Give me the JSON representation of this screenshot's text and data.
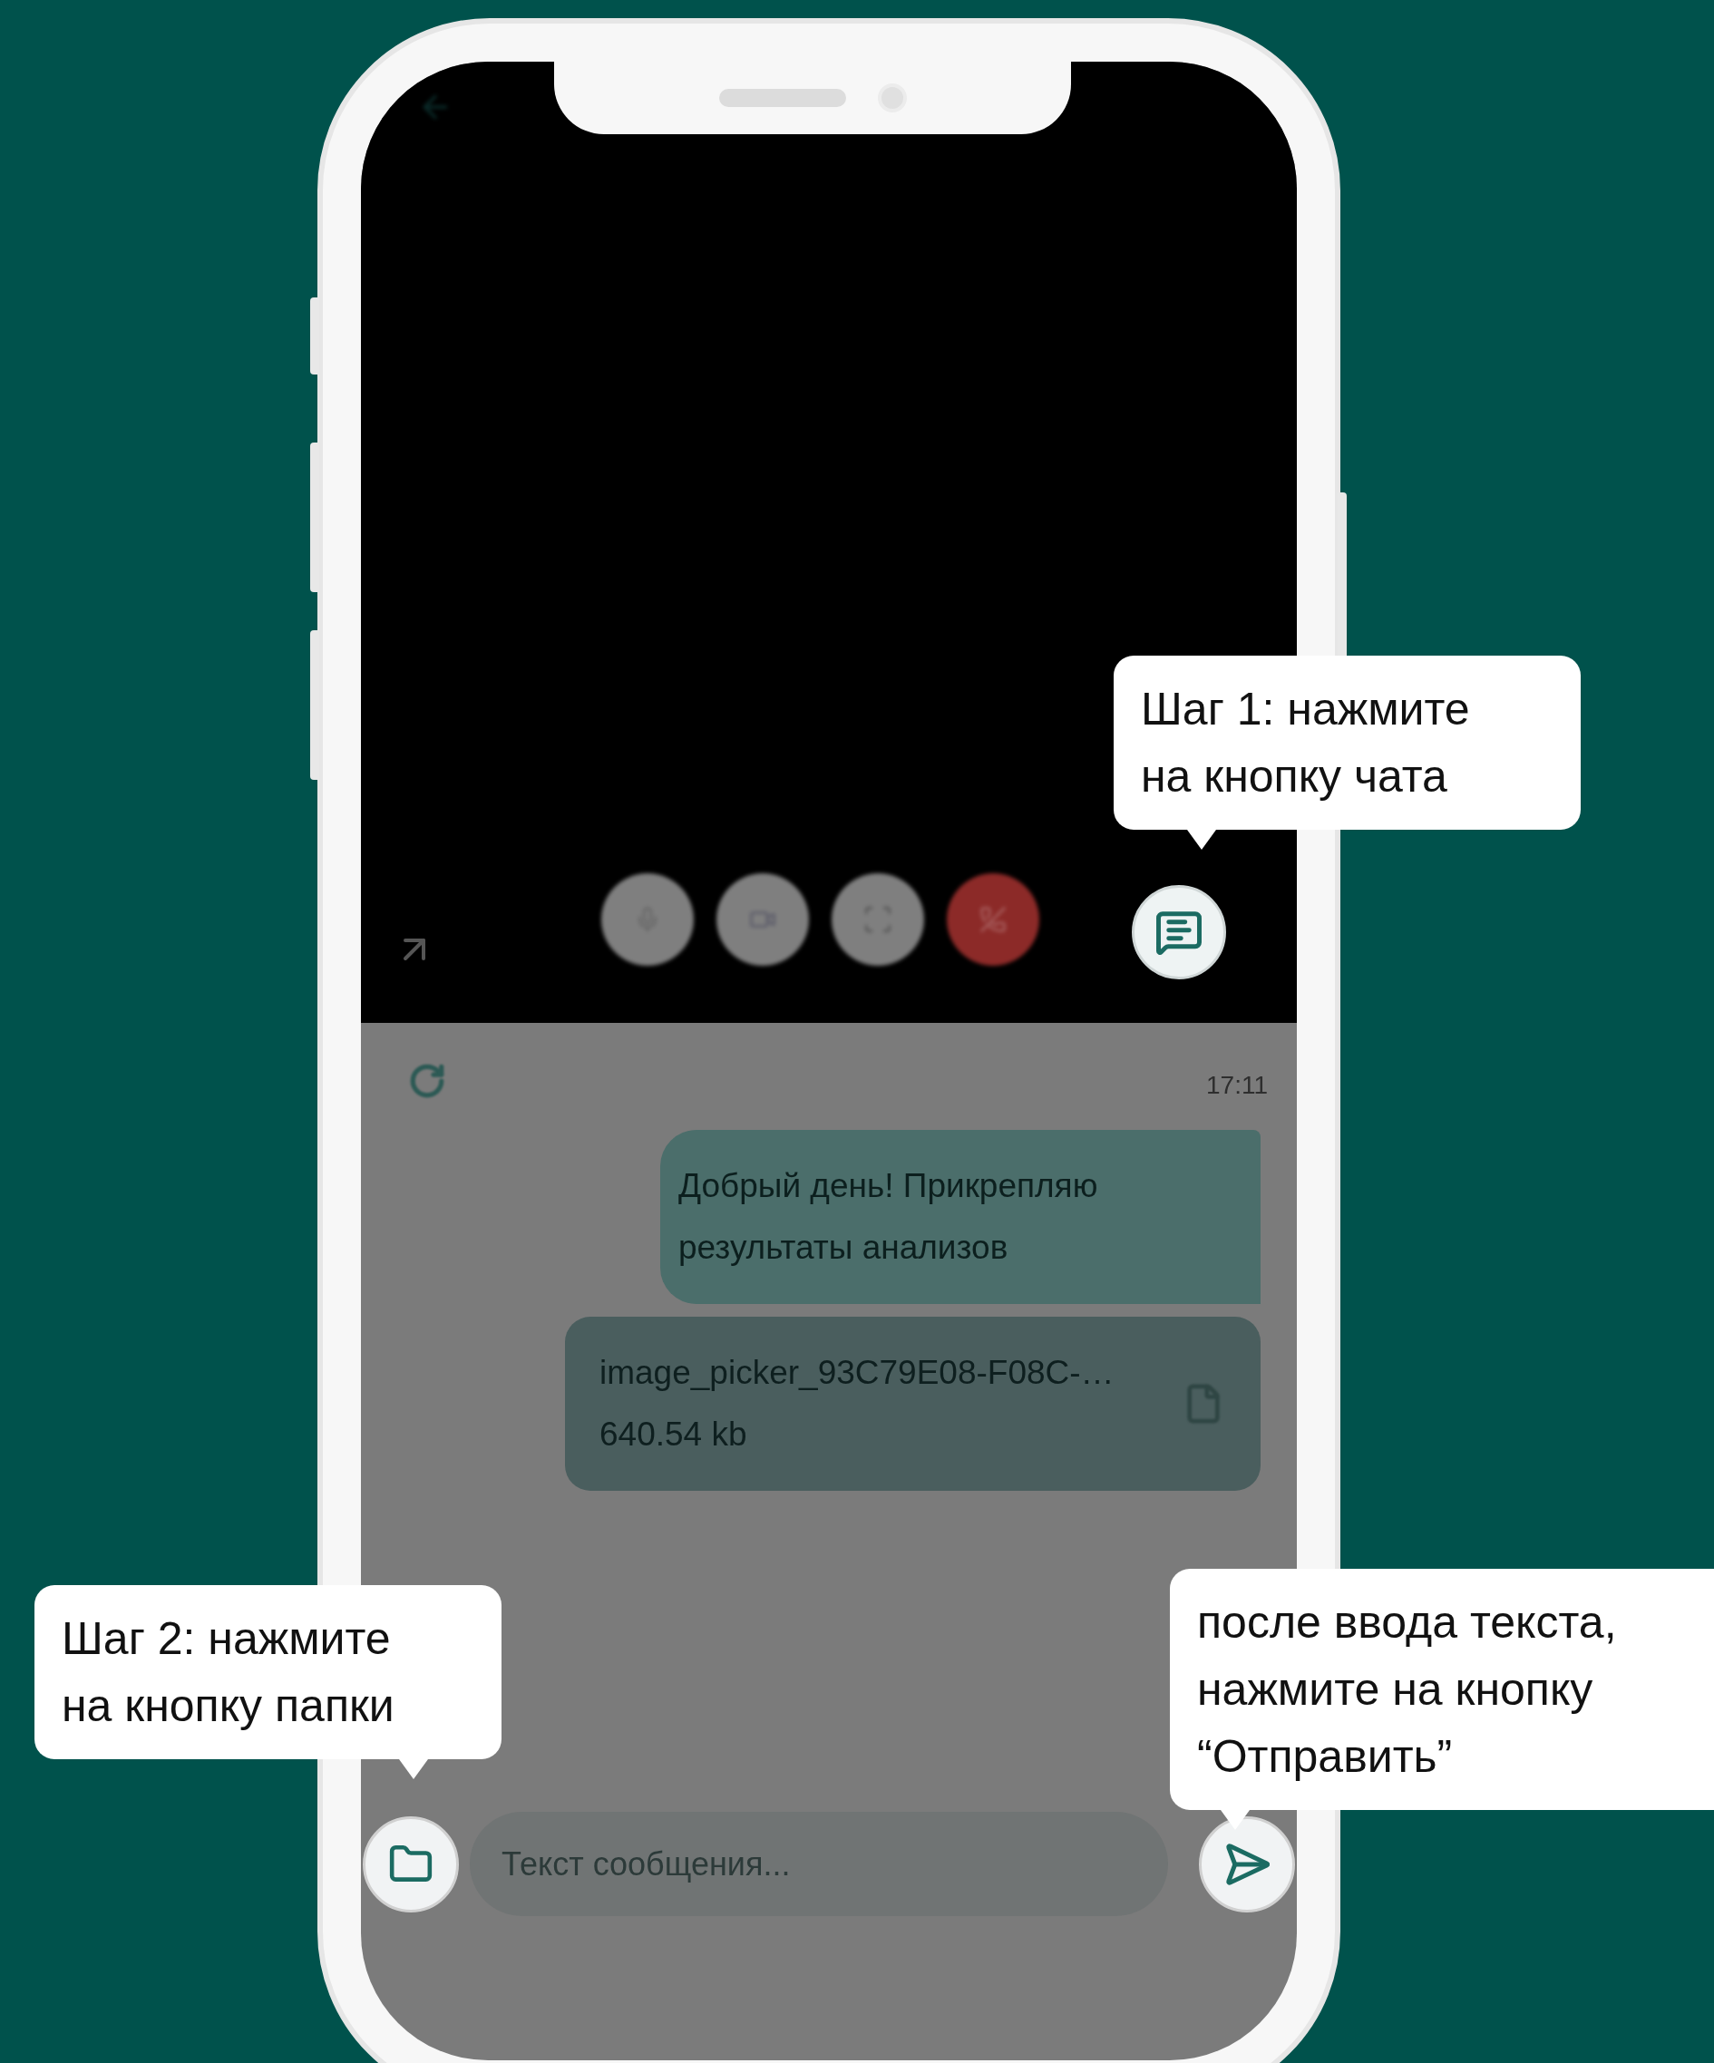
{
  "chat": {
    "time": "17:11",
    "messages": [
      {
        "kind": "text",
        "text": "Добрый день! Прикрепляю результаты анализов"
      },
      {
        "kind": "file",
        "name": "image_picker_93C79E08-F08C-…",
        "size": "640.54 kb"
      }
    ],
    "input": {
      "placeholder": "Текст сообщения..."
    }
  },
  "callouts": [
    {
      "text": "Шаг 1: нажмите\nна кнопку чата"
    },
    {
      "text": "Шаг 2: нажмите\nна кнопку папки"
    },
    {
      "text": "после ввода текста,\nнажмите на кнопку\n“Отправить”"
    }
  ]
}
